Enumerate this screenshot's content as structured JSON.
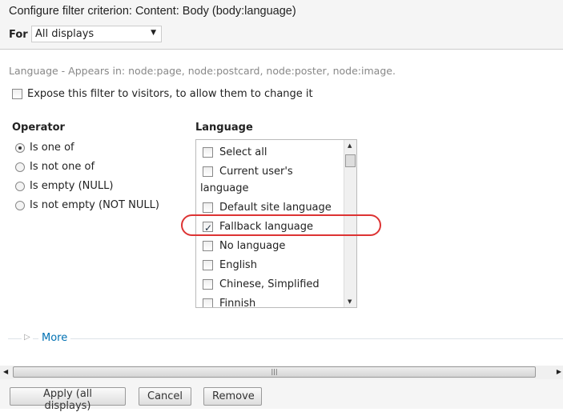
{
  "header": {
    "title": "Configure filter criterion: Content: Body (body:language)",
    "for_label": "For",
    "for_value": "All displays"
  },
  "description": "Language - Appears in: node:page, node:postcard, node:poster, node:image.",
  "expose_label": "Expose this filter to visitors, to allow them to change it",
  "operator": {
    "heading": "Operator",
    "options": [
      {
        "label": "Is one of",
        "selected": true
      },
      {
        "label": "Is not one of"
      },
      {
        "label": "Is empty (NULL)"
      },
      {
        "label": "Is not empty (NOT NULL)"
      }
    ]
  },
  "language": {
    "heading": "Language",
    "items": [
      {
        "label": "Select all",
        "checked": false
      },
      {
        "label": "Current user's",
        "checked": false
      },
      {
        "label": "language",
        "checked": false
      },
      {
        "label": "Default site language",
        "checked": false
      },
      {
        "label": "Fallback language",
        "checked": true
      },
      {
        "label": "No language",
        "checked": false
      },
      {
        "label": "English",
        "checked": false
      },
      {
        "label": "Chinese, Simplified",
        "checked": false
      },
      {
        "label": "Finnish",
        "checked": false
      }
    ]
  },
  "more_label": "More",
  "footer": {
    "apply": "Apply (all displays)",
    "cancel": "Cancel",
    "remove": "Remove"
  }
}
